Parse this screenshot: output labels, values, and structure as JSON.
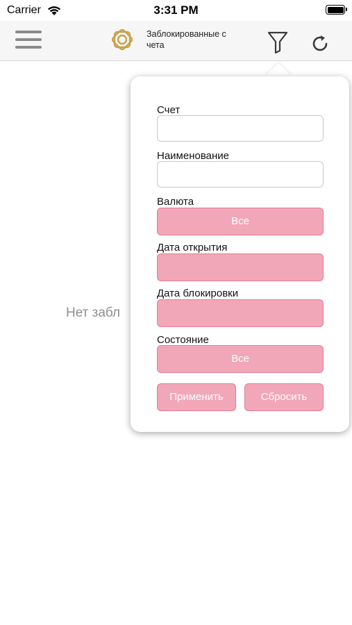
{
  "status_bar": {
    "carrier": "Carrier",
    "time": "3:31 PM"
  },
  "navbar": {
    "title": "Заблокированные счета",
    "icons": [
      "menu-icon",
      "logo-icon",
      "filter-icon",
      "refresh-icon"
    ],
    "logo_color": "#c9a04a"
  },
  "empty_state": {
    "text": "Нет забл"
  },
  "filter": {
    "account_label": "Счет",
    "account_value": "",
    "name_label": "Наименование",
    "name_value": "",
    "currency_label": "Валюта",
    "currency_value": "Все",
    "open_date_label": "Дата открытия",
    "open_date_value": "",
    "block_date_label": "Дата блокировки",
    "block_date_value": "",
    "state_label": "Состояние",
    "state_value": "Все",
    "apply_label": "Применить",
    "reset_label": "Сбросить"
  },
  "colors": {
    "button_fill": "#f1a7b7",
    "button_border": "#e07c95"
  }
}
